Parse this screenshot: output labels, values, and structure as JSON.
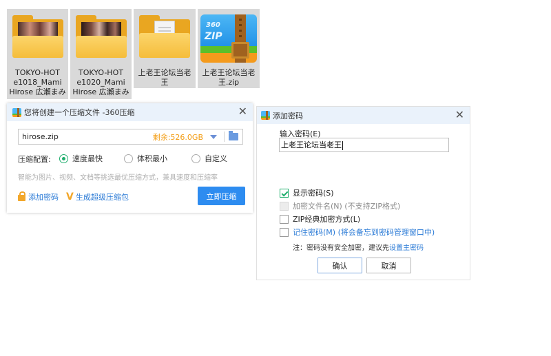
{
  "files": [
    {
      "name": "TOKYO-HOT\ne1018_Mami\nHirose 広瀬まみ",
      "type": "folder-photo-1"
    },
    {
      "name": "TOKYO-HOT\ne1020_Mami\nHirose 広瀬まみ",
      "type": "folder-photo-2"
    },
    {
      "name": "上老王论坛当老\n王",
      "type": "folder-doc"
    },
    {
      "name": "上老王论坛当老\n王.zip",
      "type": "zip"
    }
  ],
  "compress_dialog": {
    "title": "您将创建一个压缩文件 -360压缩",
    "filename": "hirose.zip",
    "free_space": "剩余:526.0GB",
    "config_label": "压缩配置:",
    "options": [
      "速度最快",
      "体积最小",
      "自定义"
    ],
    "selected_option": "速度最快",
    "hint": "智能为图片、视频、文档等挑选最优压缩方式，兼具速度和压缩率",
    "add_password": "添加密码",
    "super_zip": "生成超级压缩包",
    "compress_button": "立即压缩"
  },
  "password_dialog": {
    "title": "添加密码",
    "input_label": "输入密码(E)",
    "password_value": "上老王论坛当老王",
    "show_password": "显示密码(S)",
    "encrypt_filenames": "加密文件名(N) (不支持ZIP格式)",
    "zip_classic": "ZIP经典加密方式(L)",
    "remember_password": "记住密码(M) (将会备忘到密码管理窗口中)",
    "note_prefix": "注：密码没有安全加密，建议先",
    "note_link": "设置主密码",
    "ok": "确认",
    "cancel": "取消"
  },
  "colors": {
    "accent": "#2d8cf0",
    "green": "#1fae6d",
    "orange": "#f39c12",
    "link": "#2a7ad6"
  }
}
